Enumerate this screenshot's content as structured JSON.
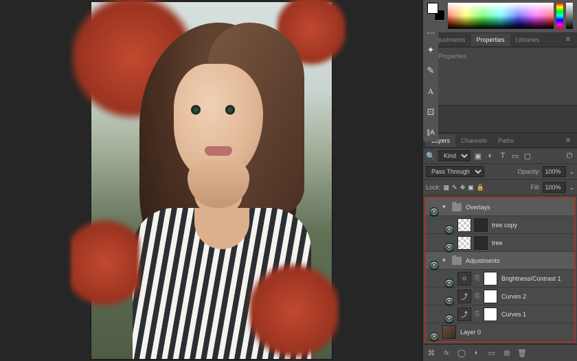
{
  "panels": {
    "properties_tabs": [
      "Adjustments",
      "Properties",
      "Libraries"
    ],
    "properties_active": "Properties",
    "properties_body": "No Properties",
    "layers_tabs": [
      "Layers",
      "Channels",
      "Paths"
    ],
    "layers_active": "Layers"
  },
  "layer_controls": {
    "kind_label": "Kind",
    "filter_icons": [
      "image",
      "adjustment",
      "type",
      "shape",
      "smartobject"
    ],
    "blend_mode": "Pass Through",
    "opacity_label": "Opacity:",
    "opacity_value": "100%",
    "lock_label": "Lock:",
    "fill_label": "Fill:",
    "fill_value": "100%"
  },
  "layers": [
    {
      "kind": "group",
      "name": "Overlays",
      "expanded": true,
      "eye": true
    },
    {
      "kind": "layer",
      "name": "tree copy",
      "indent": 1,
      "eye": true,
      "thumb": "checker"
    },
    {
      "kind": "layer",
      "name": "tree",
      "indent": 1,
      "eye": true,
      "thumb": "checker"
    },
    {
      "kind": "group",
      "name": "Adjustments",
      "indent": 0,
      "expanded": true,
      "eye": true
    },
    {
      "kind": "adjustment",
      "name": "Brightness/Contrast 1",
      "indent": 1,
      "eye": true,
      "adj_icon": "☼",
      "mask": true
    },
    {
      "kind": "adjustment",
      "name": "Curves 2",
      "indent": 1,
      "eye": true,
      "adj_icon": "⤴",
      "mask": true
    },
    {
      "kind": "adjustment",
      "name": "Curves 1",
      "indent": 1,
      "eye": true,
      "adj_icon": "⤴",
      "mask": true
    },
    {
      "kind": "image",
      "name": "Layer 0",
      "indent": 0,
      "eye": true,
      "thumb": "img"
    }
  ],
  "footer_icons": {
    "link": "⌘",
    "fx": "fx",
    "mask": "◯",
    "adjust": "◐",
    "group": "▱",
    "new": "⊞",
    "trash": "🗑"
  },
  "tool_column": [
    "▶",
    "⬚",
    "⊹",
    "✎",
    "A",
    "⊡",
    "⋮A"
  ]
}
